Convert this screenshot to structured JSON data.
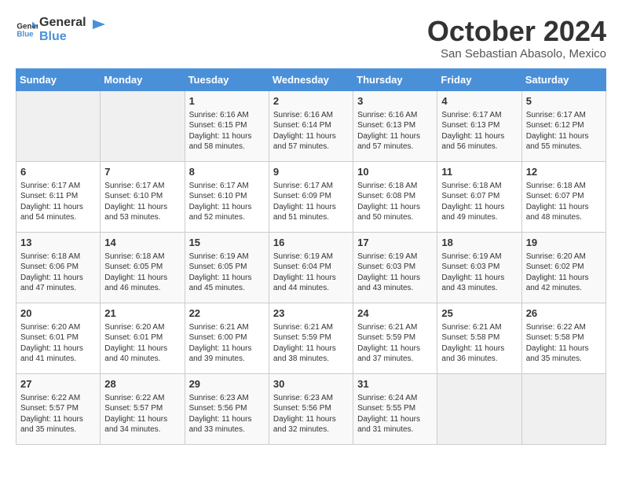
{
  "logo": {
    "line1": "General",
    "line2": "Blue"
  },
  "title": "October 2024",
  "location": "San Sebastian Abasolo, Mexico",
  "days_of_week": [
    "Sunday",
    "Monday",
    "Tuesday",
    "Wednesday",
    "Thursday",
    "Friday",
    "Saturday"
  ],
  "weeks": [
    [
      {
        "day": "",
        "info": ""
      },
      {
        "day": "",
        "info": ""
      },
      {
        "day": "1",
        "info": "Sunrise: 6:16 AM\nSunset: 6:15 PM\nDaylight: 11 hours and 58 minutes."
      },
      {
        "day": "2",
        "info": "Sunrise: 6:16 AM\nSunset: 6:14 PM\nDaylight: 11 hours and 57 minutes."
      },
      {
        "day": "3",
        "info": "Sunrise: 6:16 AM\nSunset: 6:13 PM\nDaylight: 11 hours and 57 minutes."
      },
      {
        "day": "4",
        "info": "Sunrise: 6:17 AM\nSunset: 6:13 PM\nDaylight: 11 hours and 56 minutes."
      },
      {
        "day": "5",
        "info": "Sunrise: 6:17 AM\nSunset: 6:12 PM\nDaylight: 11 hours and 55 minutes."
      }
    ],
    [
      {
        "day": "6",
        "info": "Sunrise: 6:17 AM\nSunset: 6:11 PM\nDaylight: 11 hours and 54 minutes."
      },
      {
        "day": "7",
        "info": "Sunrise: 6:17 AM\nSunset: 6:10 PM\nDaylight: 11 hours and 53 minutes."
      },
      {
        "day": "8",
        "info": "Sunrise: 6:17 AM\nSunset: 6:10 PM\nDaylight: 11 hours and 52 minutes."
      },
      {
        "day": "9",
        "info": "Sunrise: 6:17 AM\nSunset: 6:09 PM\nDaylight: 11 hours and 51 minutes."
      },
      {
        "day": "10",
        "info": "Sunrise: 6:18 AM\nSunset: 6:08 PM\nDaylight: 11 hours and 50 minutes."
      },
      {
        "day": "11",
        "info": "Sunrise: 6:18 AM\nSunset: 6:07 PM\nDaylight: 11 hours and 49 minutes."
      },
      {
        "day": "12",
        "info": "Sunrise: 6:18 AM\nSunset: 6:07 PM\nDaylight: 11 hours and 48 minutes."
      }
    ],
    [
      {
        "day": "13",
        "info": "Sunrise: 6:18 AM\nSunset: 6:06 PM\nDaylight: 11 hours and 47 minutes."
      },
      {
        "day": "14",
        "info": "Sunrise: 6:18 AM\nSunset: 6:05 PM\nDaylight: 11 hours and 46 minutes."
      },
      {
        "day": "15",
        "info": "Sunrise: 6:19 AM\nSunset: 6:05 PM\nDaylight: 11 hours and 45 minutes."
      },
      {
        "day": "16",
        "info": "Sunrise: 6:19 AM\nSunset: 6:04 PM\nDaylight: 11 hours and 44 minutes."
      },
      {
        "day": "17",
        "info": "Sunrise: 6:19 AM\nSunset: 6:03 PM\nDaylight: 11 hours and 43 minutes."
      },
      {
        "day": "18",
        "info": "Sunrise: 6:19 AM\nSunset: 6:03 PM\nDaylight: 11 hours and 43 minutes."
      },
      {
        "day": "19",
        "info": "Sunrise: 6:20 AM\nSunset: 6:02 PM\nDaylight: 11 hours and 42 minutes."
      }
    ],
    [
      {
        "day": "20",
        "info": "Sunrise: 6:20 AM\nSunset: 6:01 PM\nDaylight: 11 hours and 41 minutes."
      },
      {
        "day": "21",
        "info": "Sunrise: 6:20 AM\nSunset: 6:01 PM\nDaylight: 11 hours and 40 minutes."
      },
      {
        "day": "22",
        "info": "Sunrise: 6:21 AM\nSunset: 6:00 PM\nDaylight: 11 hours and 39 minutes."
      },
      {
        "day": "23",
        "info": "Sunrise: 6:21 AM\nSunset: 5:59 PM\nDaylight: 11 hours and 38 minutes."
      },
      {
        "day": "24",
        "info": "Sunrise: 6:21 AM\nSunset: 5:59 PM\nDaylight: 11 hours and 37 minutes."
      },
      {
        "day": "25",
        "info": "Sunrise: 6:21 AM\nSunset: 5:58 PM\nDaylight: 11 hours and 36 minutes."
      },
      {
        "day": "26",
        "info": "Sunrise: 6:22 AM\nSunset: 5:58 PM\nDaylight: 11 hours and 35 minutes."
      }
    ],
    [
      {
        "day": "27",
        "info": "Sunrise: 6:22 AM\nSunset: 5:57 PM\nDaylight: 11 hours and 35 minutes."
      },
      {
        "day": "28",
        "info": "Sunrise: 6:22 AM\nSunset: 5:57 PM\nDaylight: 11 hours and 34 minutes."
      },
      {
        "day": "29",
        "info": "Sunrise: 6:23 AM\nSunset: 5:56 PM\nDaylight: 11 hours and 33 minutes."
      },
      {
        "day": "30",
        "info": "Sunrise: 6:23 AM\nSunset: 5:56 PM\nDaylight: 11 hours and 32 minutes."
      },
      {
        "day": "31",
        "info": "Sunrise: 6:24 AM\nSunset: 5:55 PM\nDaylight: 11 hours and 31 minutes."
      },
      {
        "day": "",
        "info": ""
      },
      {
        "day": "",
        "info": ""
      }
    ]
  ]
}
